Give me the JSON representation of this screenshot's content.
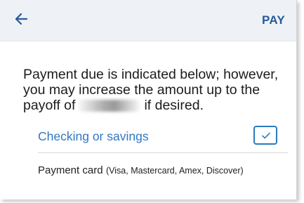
{
  "header": {
    "back_icon": "arrow-left-icon",
    "action_label": "PAY"
  },
  "message": {
    "before": "Payment due is indicated below; however, you may increase the amount up to the payoff of",
    "after": "if desired."
  },
  "options": [
    {
      "label": "Checking or savings",
      "checked": true
    },
    {
      "label": "Payment card",
      "detail": "(Visa, Mastercard, Amex, Discover)",
      "checked": false
    }
  ],
  "colors": {
    "accent": "#2f78c4",
    "header_bg": "#eef1f5",
    "header_text": "#265b9a",
    "text": "#1c1c1c"
  }
}
